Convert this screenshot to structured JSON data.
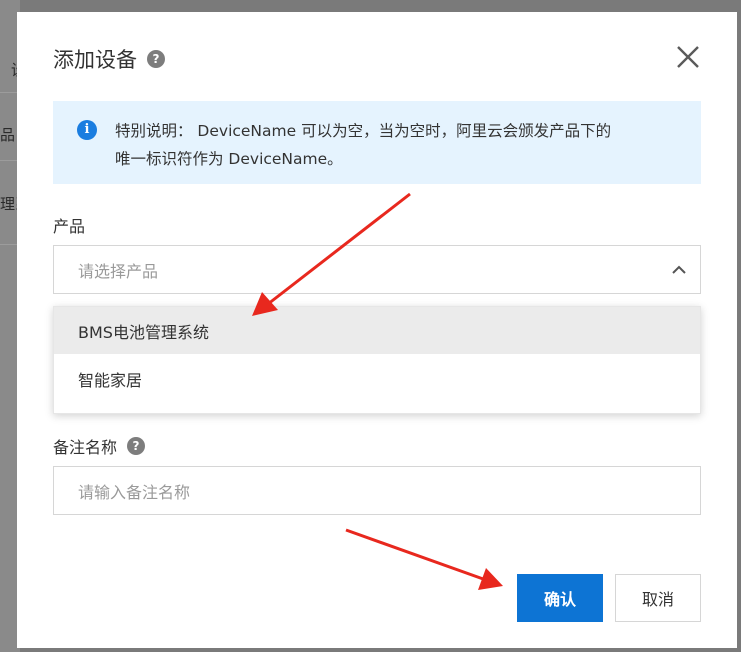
{
  "background": {
    "fragments": [
      "设",
      "品",
      "理系"
    ]
  },
  "dialog": {
    "title": "添加设备",
    "help_glyph": "?",
    "close_glyph": "close-icon"
  },
  "notice": {
    "icon": "info-icon",
    "line1": "特别说明： DeviceName 可以为空，当为空时，阿里云会颁发产品下的",
    "line2": "唯一标识符作为 DeviceName。"
  },
  "product": {
    "label": "产品",
    "placeholder": "请选择产品",
    "options": [
      "BMS电池管理系统",
      "智能家居"
    ],
    "highlighted_option": "BMS电池管理系统"
  },
  "note": {
    "label": "备注名称",
    "placeholder": "请输入备注名称"
  },
  "footer": {
    "confirm_label": "确认",
    "cancel_label": "取消"
  },
  "colors": {
    "primary": "#0d74d4",
    "info_bg": "#e5f3fe",
    "annotation_arrow": "#e8281e"
  }
}
